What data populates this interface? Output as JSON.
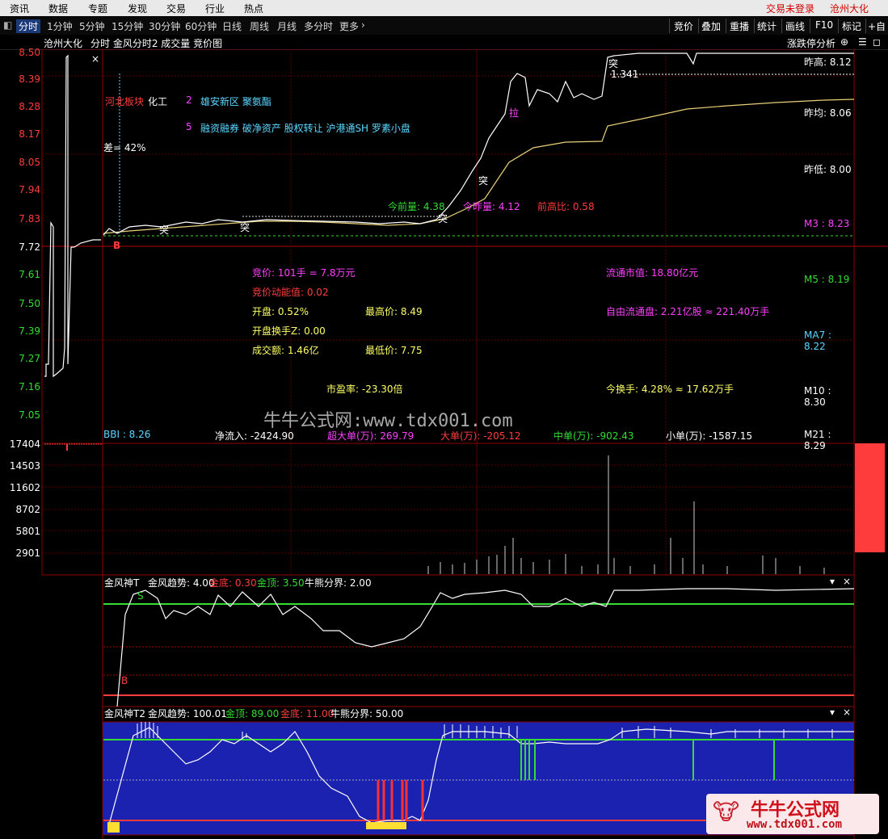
{
  "menu": {
    "items": [
      "资讯",
      "数据",
      "专题",
      "发现",
      "交易",
      "行业",
      "热点"
    ],
    "right": [
      "交易未登录",
      "沧州大化"
    ]
  },
  "periods": [
    "分时",
    "1分钟",
    "5分钟",
    "15分钟",
    "30分钟",
    "60分钟",
    "日线",
    "周线",
    "月线",
    "多分时",
    "更多"
  ],
  "toolbar_right": [
    "竞价",
    "叠加",
    "重播",
    "统计",
    "画线",
    "F10",
    "标记",
    "+自选"
  ],
  "title": {
    "stock": "沧州大化",
    "indicators": "分时  金风分时2  成交量  竞价图",
    "right_label": "涨跌停分析"
  },
  "price_axis": [
    "8.50",
    "8.39",
    "8.28",
    "8.17",
    "8.05",
    "7.94",
    "7.83",
    "7.72",
    "7.61",
    "7.50",
    "7.39",
    "7.27",
    "7.16",
    "7.05"
  ],
  "volume_axis": [
    "17404",
    "14503",
    "11602",
    "8702",
    "5801",
    "2901"
  ],
  "right_panel": {
    "prev_high": "昨高: 8.12",
    "prev_avg": "昨均: 8.06",
    "prev_low": "昨低: 8.00",
    "m3": "M3 : 8.23",
    "m5": "M5 : 8.19",
    "ma7": "MA7 : 8.22",
    "m10": "M10 : 8.30",
    "m21": "M21 : 8.29"
  },
  "sector": {
    "board": "河北板块",
    "industry": "化工",
    "num1": "2",
    "concepts1": "雄安新区 聚氨酯",
    "num2": "5",
    "concepts2": "融资融券 破净资产 股权转让 沪港通SH 罗素小盘"
  },
  "diff_label": "差= 42%",
  "marks": {
    "b": "B",
    "tu": "突",
    "la": "拉",
    "top_value": "1.341"
  },
  "volume_stats": {
    "today_prev_vol": "今前量: 4.38",
    "today_vol_ratio": "今昨量: 4.12",
    "prev_high_ratio": "前高比: 0.58"
  },
  "info": {
    "auction": "竞价: 101手 = 7.8万元",
    "auction_energy": "竞价动能值: 0.02",
    "open": "开盘: 0.52%",
    "open_turnover": "开盘换手Z: 0.00",
    "amount": "成交额: 1.46亿",
    "high": "最高价: 8.49",
    "low": "最低价: 7.75",
    "float_mv": "流通市值: 18.80亿元",
    "free_float": "自由流通盘: 2.21亿股 ≈ 221.40万手",
    "pe": "市盈率: -23.30倍",
    "turnover": "今换手: 4.28% ≈ 17.62万手"
  },
  "flow": {
    "bbi": "BBI : 8.26",
    "net": "净流入: -2424.90",
    "super": "超大单(万): 269.79",
    "large": "大单(万): -205.12",
    "mid": "中单(万): -902.43",
    "small": "小单(万): -1587.15"
  },
  "watermark": "牛牛公式网:www.tdx001.com",
  "panel1": {
    "name": "金风神T",
    "trend": "金风趋势: 4.00",
    "bottom": "金底: 0.30",
    "top": "金顶: 3.50",
    "divide": "牛熊分界: 2.00"
  },
  "panel2": {
    "name": "金风神T2",
    "trend": "金风趋势: 100.01",
    "top": "金顶: 89.00",
    "bottom": "金底: 11.00",
    "divide": "牛熊分界: 50.00"
  },
  "logo": {
    "name": "牛牛公式网",
    "url": "www.tdx001.com"
  },
  "colors": {
    "axis_red": "#ff3c3c",
    "axis_green": "#33dd33",
    "frame": "#8a0000",
    "panel2_bg": "#1c22b0"
  }
}
